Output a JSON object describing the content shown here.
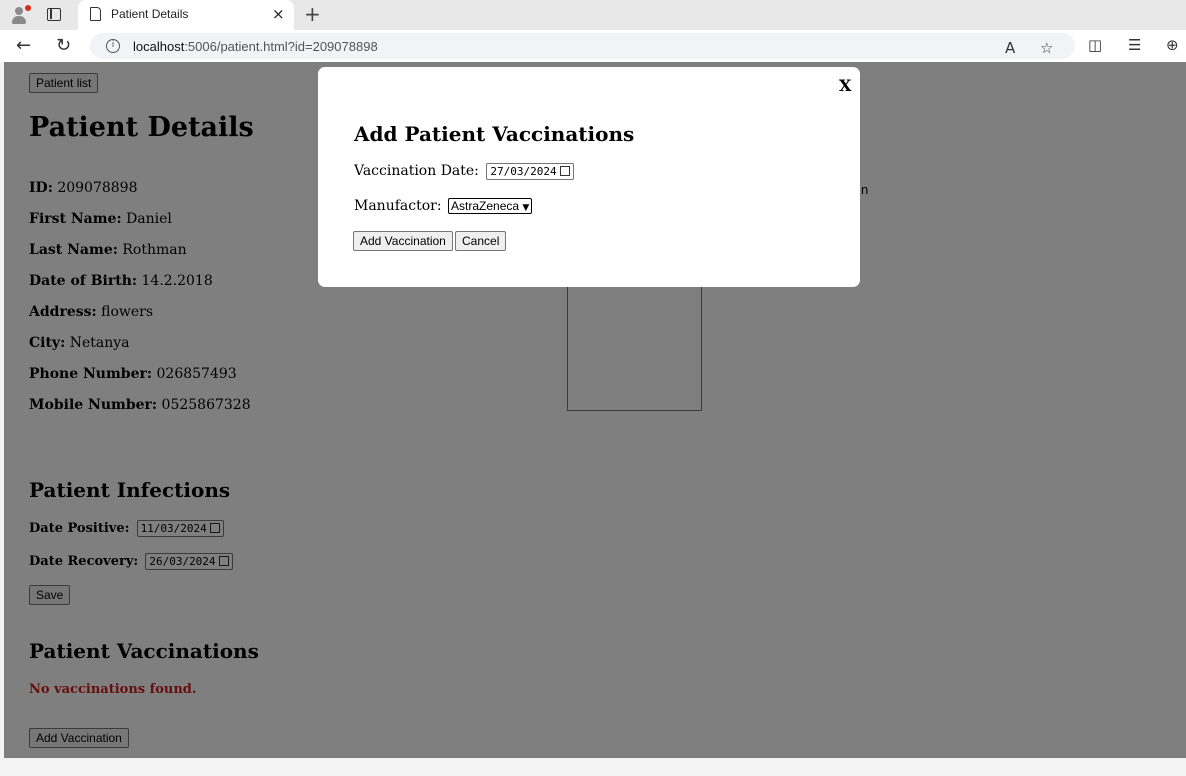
{
  "browser": {
    "tab_title": "Patient Details",
    "tab_close": "×",
    "new_tab": "+",
    "url_host": "localhost",
    "url_rest": ":5006/patient.html?id=209078898",
    "info_glyph": "i",
    "back_glyph": "←",
    "reload_glyph": "↻",
    "read_aloud_glyph": "A",
    "favorite_glyph": "☆",
    "split_glyph": "◫",
    "favorites_glyph": "☰",
    "collections_glyph": "⊕"
  },
  "page": {
    "patient_list_button": "Patient list",
    "title": "Patient Details",
    "fields": [
      {
        "label": "ID:",
        "value": "209078898"
      },
      {
        "label": "First Name:",
        "value": "Daniel"
      },
      {
        "label": "Last Name:",
        "value": "Rothman"
      },
      {
        "label": "Date of Birth:",
        "value": "14.2.2018"
      },
      {
        "label": "Address:",
        "value": "flowers"
      },
      {
        "label": "City:",
        "value": "Netanya"
      },
      {
        "label": "Phone Number:",
        "value": "026857493"
      },
      {
        "label": "Mobile Number:",
        "value": "0525867328"
      }
    ],
    "side_fragment": "n",
    "infections_heading": "Patient Infections",
    "date_positive_label": "Date Positive:",
    "date_positive_value": "11/03/2024",
    "date_recovery_label": "Date Recovery:",
    "date_recovery_value": "26/03/2024",
    "save_button": "Save",
    "vaccinations_heading": "Patient Vaccinations",
    "no_vaccinations": "No vaccinations found.",
    "add_vaccination_button": "Add Vaccination"
  },
  "modal": {
    "close": "X",
    "title": "Add Patient Vaccinations",
    "date_label": "Vaccination Date:",
    "date_value": "27/03/2024",
    "manufacturer_label": "Manufactor:",
    "manufacturer_value": "AstraZeneca",
    "add_button": "Add Vaccination",
    "cancel_button": "Cancel"
  }
}
